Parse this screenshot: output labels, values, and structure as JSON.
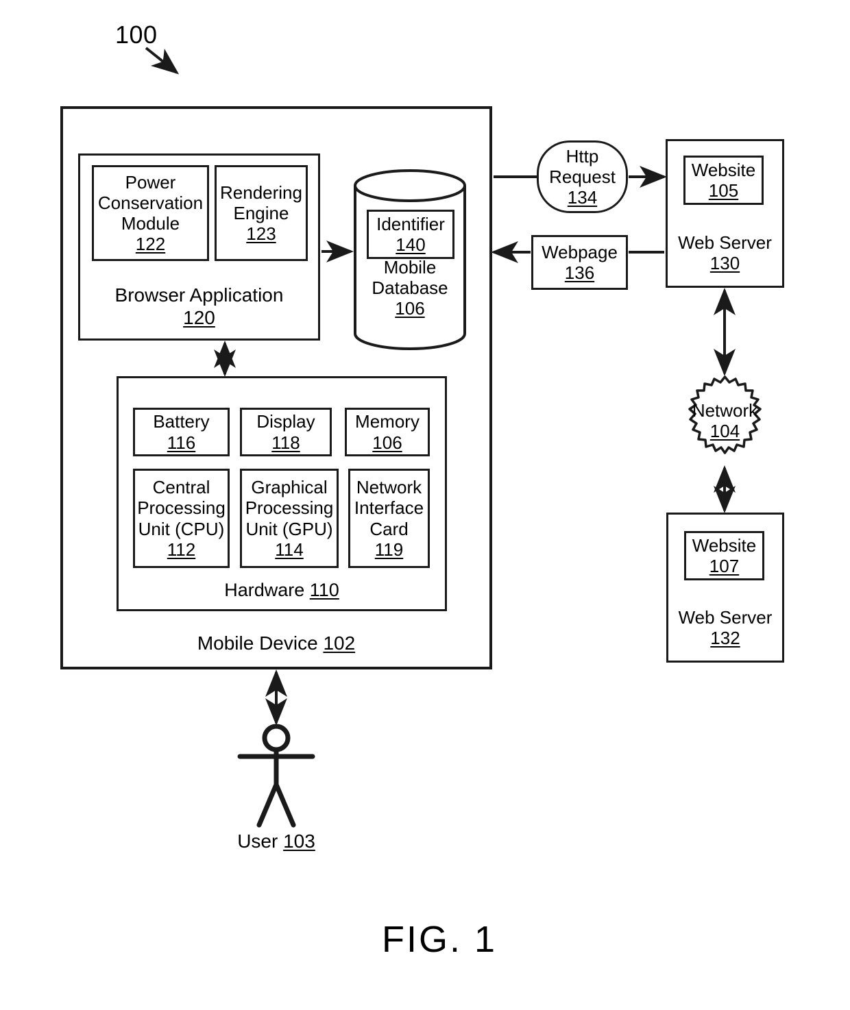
{
  "figure": {
    "ref_number": "100",
    "caption": "FIG. 1"
  },
  "mobile_device": {
    "label": "Mobile Device ",
    "number": "102"
  },
  "browser_application": {
    "label": "Browser Application",
    "number": "120",
    "modules": [
      {
        "label": "Power\nConservation\nModule",
        "number": "122",
        "name": "power-conservation-module"
      },
      {
        "label": "Rendering\nEngine",
        "number": "123",
        "name": "rendering-engine"
      }
    ]
  },
  "mobile_database": {
    "label": "Mobile\nDatabase",
    "number": "106",
    "identifier": {
      "label": "Identifier",
      "number": "140"
    }
  },
  "hardware": {
    "label": "Hardware ",
    "number": "110",
    "components": [
      {
        "label": "Battery",
        "number": "116",
        "name": "battery"
      },
      {
        "label": "Display",
        "number": "118",
        "name": "display"
      },
      {
        "label": "Memory",
        "number": "106",
        "name": "memory"
      },
      {
        "label": "Central\nProcessing\nUnit (CPU)",
        "number": "112",
        "name": "cpu"
      },
      {
        "label": "Graphical\nProcessing\nUnit (GPU)",
        "number": "114",
        "name": "gpu"
      },
      {
        "label": "Network\nInterface\nCard",
        "number": "119",
        "name": "network-interface-card"
      }
    ]
  },
  "user": {
    "label": "User ",
    "number": "103"
  },
  "http_request": {
    "label": "Http\nRequest",
    "number": "134"
  },
  "webpage": {
    "label": "Webpage",
    "number": "136"
  },
  "web_server_130": {
    "label": "Web Server",
    "number": "130",
    "website": {
      "label": "Website",
      "number": "105"
    }
  },
  "web_server_132": {
    "label": "Web Server",
    "number": "132",
    "website": {
      "label": "Website",
      "number": "107"
    }
  },
  "network": {
    "label": "Network",
    "number": "104"
  },
  "colors": {
    "ink": "#1a1a1a",
    "background": "#ffffff"
  }
}
